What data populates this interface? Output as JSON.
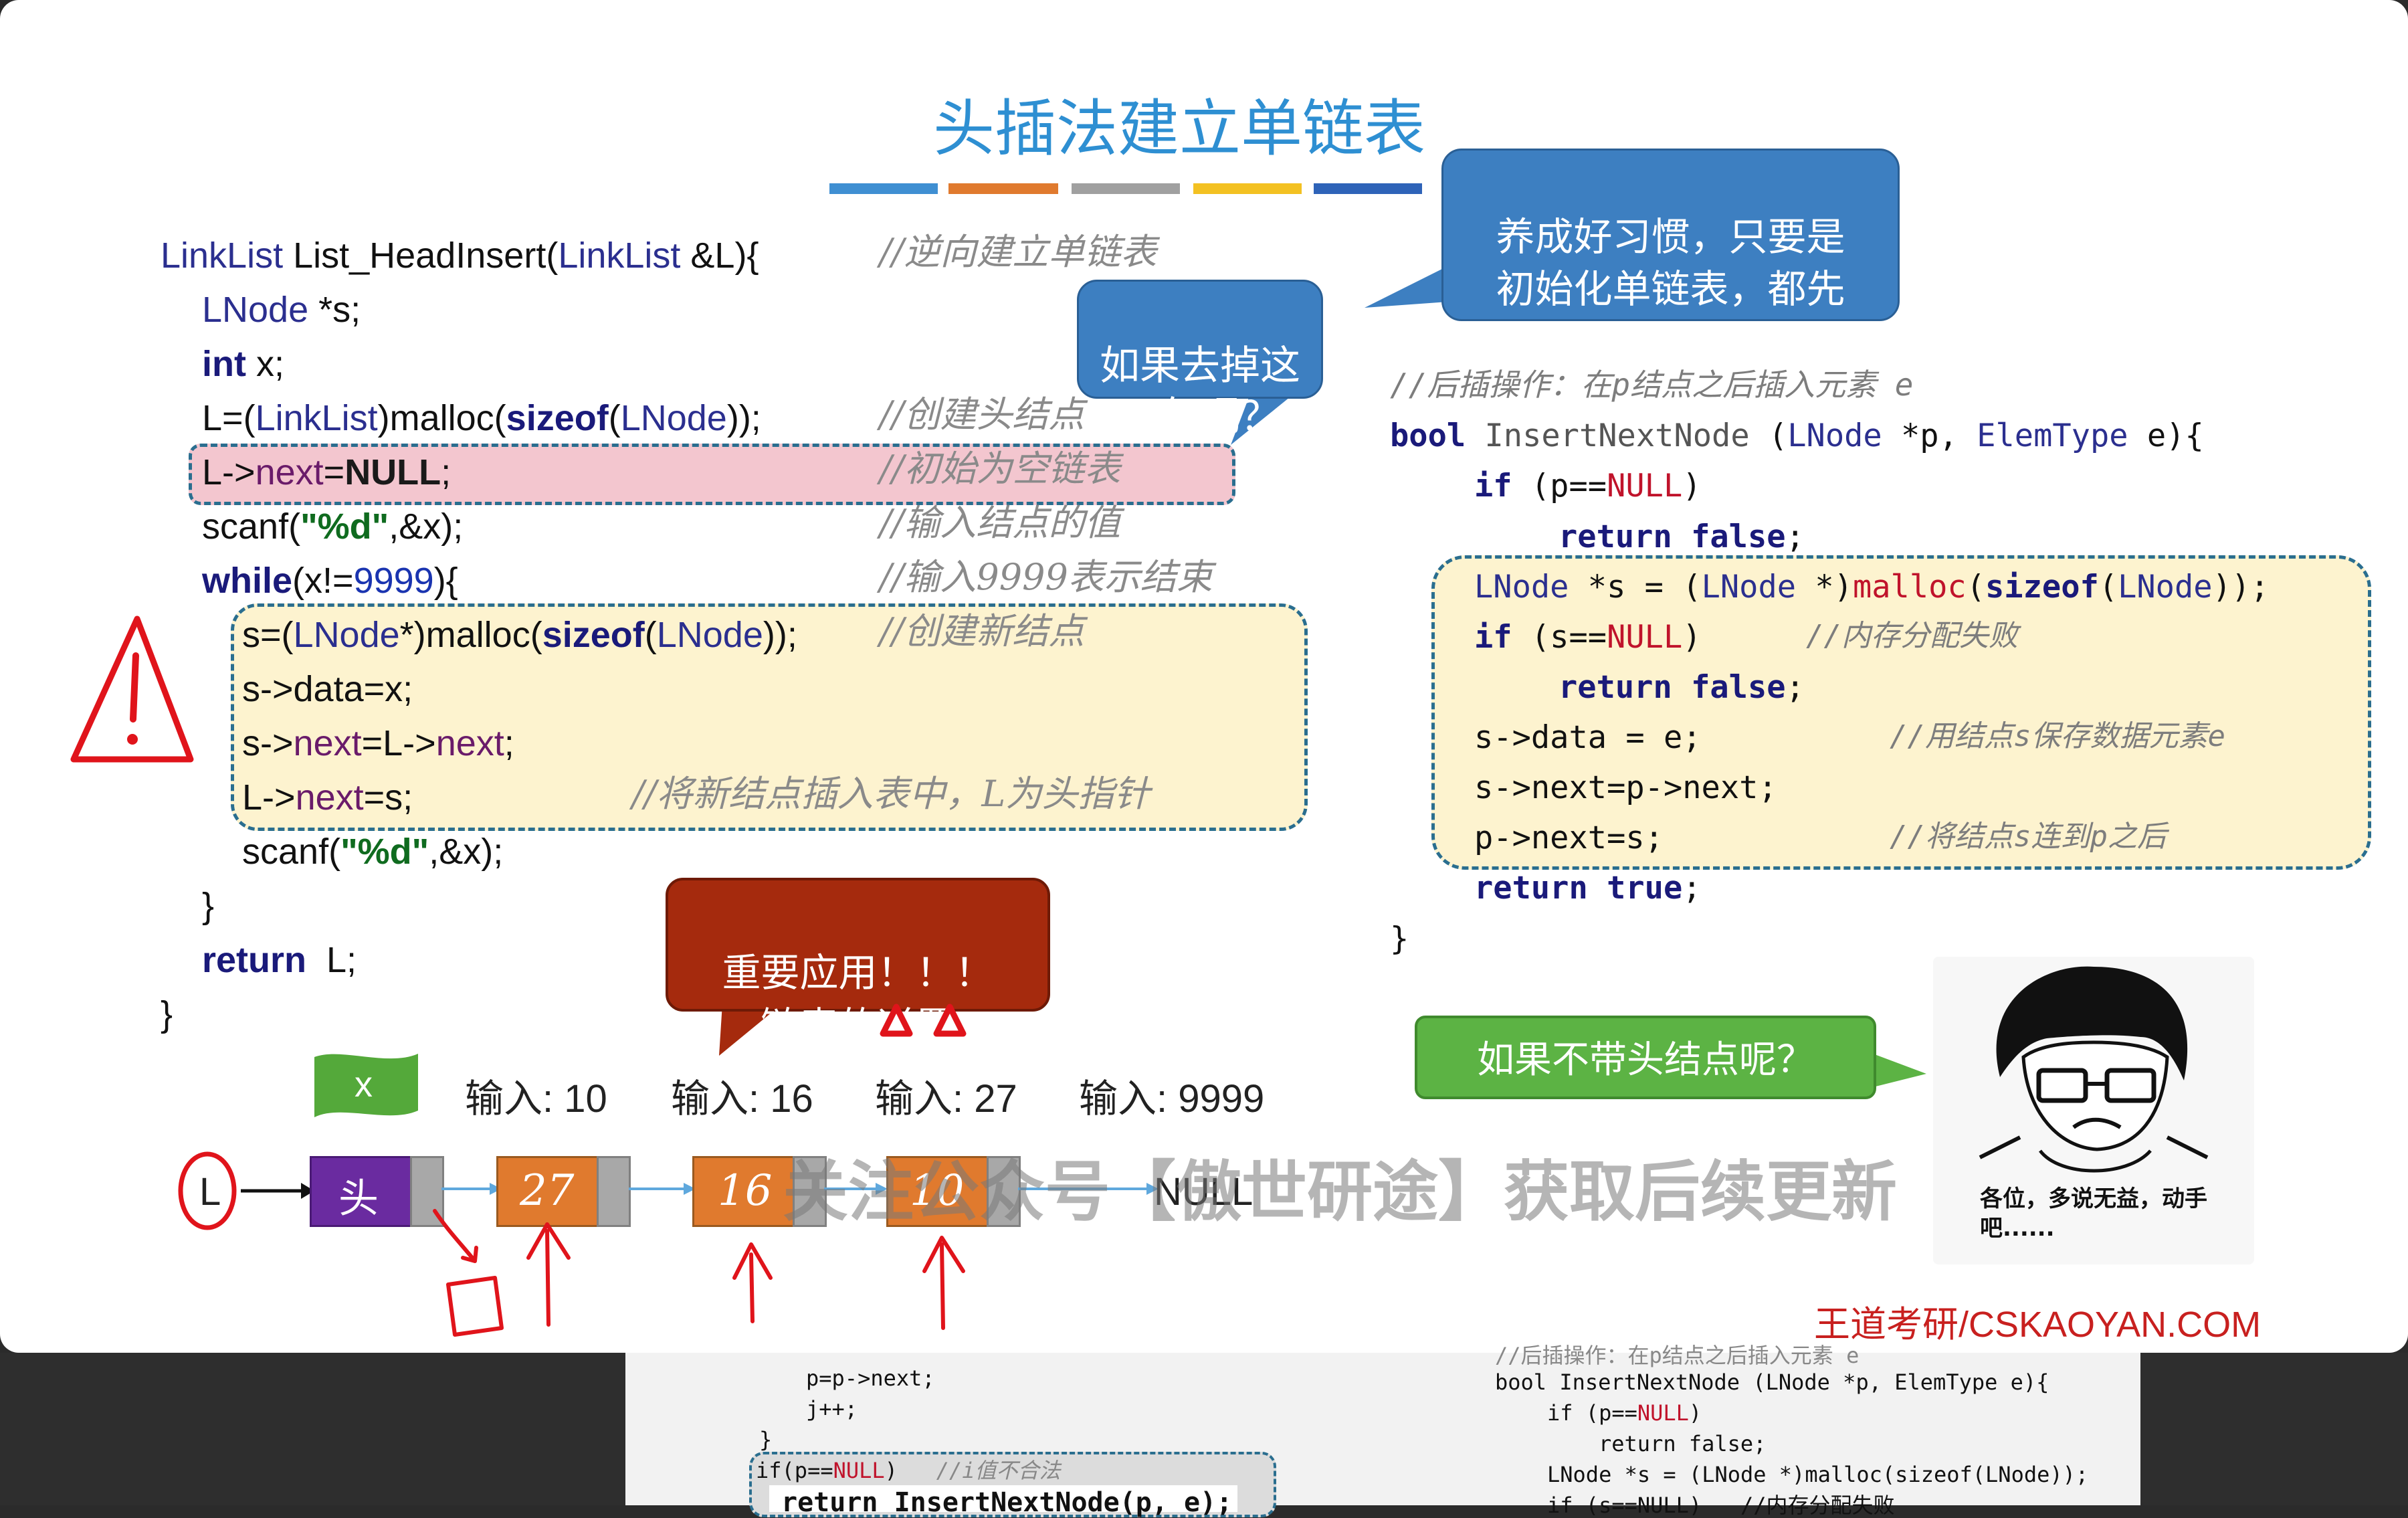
{
  "slide": {
    "title": "头插法建立单链表",
    "accent_colors": [
      "#3f8fd2",
      "#e07a2e",
      "#a0a0a0",
      "#f3c122",
      "#2e63b8"
    ]
  },
  "left_code": {
    "l1": {
      "type": "LinkList",
      "fn": "List_HeadInsert",
      "paren": "(",
      "type2": "LinkList",
      "arg": " &L){",
      "comment": "//逆向建立单链表"
    },
    "l2": {
      "type": "LNode",
      "rest": " *s;"
    },
    "l3": {
      "kw": "int",
      "rest": " x;"
    },
    "l4": {
      "a": "L=(",
      "type": "LinkList",
      "b": ")malloc(",
      "kw": "sizeof",
      "c": "(",
      "type2": "LNode",
      "d": "));",
      "comment": "//创建头结点"
    },
    "l5": {
      "a": "L->",
      "fn": "next",
      "b": "=",
      "kw": "NULL",
      "c": ";",
      "comment": "//初始为空链表"
    },
    "l6": {
      "a": "scanf(",
      "str": "\"%d\"",
      "b": ",&x);",
      "comment": "//输入结点的值"
    },
    "l7": {
      "kw": "while",
      "a": "(x!=",
      "num": "9999",
      "b": "){",
      "comment": "//输入9999表示结束"
    },
    "l8": {
      "a": "s=(",
      "type": "LNode",
      "b": "*)malloc(",
      "kw": "sizeof",
      "c": "(",
      "type2": "LNode",
      "d": "));",
      "comment": "//创建新结点"
    },
    "l9": {
      "a": "s->data=x;"
    },
    "l10": {
      "a": "s->",
      "fn": "next",
      "b": "=L->",
      "fn2": "next",
      "c": ";"
    },
    "l11": {
      "a": "L->",
      "fn": "next",
      "b": "=s;",
      "comment": "//将新结点插入表中，L为头指针"
    },
    "l12": {
      "a": "scanf(",
      "str": "\"%d\"",
      "b": ",&x);"
    },
    "l13": {
      "a": "}"
    },
    "l14": {
      "kw": "return",
      "a": "  L;"
    },
    "l15": {
      "a": "}"
    }
  },
  "right_code": {
    "c0": "//后插操作：在p结点之后插入元素 e",
    "r1": {
      "kw": "bool",
      "fn": " InsertNextNode ",
      "a": "(",
      "type": "LNode",
      "b": " *p, ",
      "type2": "ElemType",
      "c": " e){"
    },
    "r2": {
      "kw": "if",
      "a": " (p==",
      "red": "NULL",
      "b": ")"
    },
    "r3": {
      "kw": "return false",
      "a": ";"
    },
    "r4": {
      "type": "LNode",
      "a": " *s = (",
      "type2": "LNode",
      "b": " *)",
      "red": "malloc",
      "c": "(",
      "kw": "sizeof",
      "d": "(",
      "type3": "LNode",
      "e": "));"
    },
    "r5": {
      "kw": "if",
      "a": " (s==",
      "red": "NULL",
      "b": ")",
      "comment": "//内存分配失败"
    },
    "r6": {
      "kw": "return false",
      "a": ";"
    },
    "r7": {
      "a": "s->data = e;",
      "comment": "//用结点s保存数据元素e"
    },
    "r8": {
      "a": "s->next=p->next;"
    },
    "r9": {
      "a": "p->next=s;",
      "comment": "//将结点s连到p之后"
    },
    "r10": {
      "kw": "return true",
      "a": ";"
    },
    "r11": {
      "a": "}"
    }
  },
  "bubbles": {
    "habit": "养成好习惯，只要是\n初始化单链表，都先\n把头指针指向 NULL",
    "remove": "如果去掉这\n一句呢？",
    "important": "重要应用！！！\n链表的逆置",
    "no_head": "如果不带头结点呢？"
  },
  "demo": {
    "x_label": "x",
    "inputs": [
      "输入: 10",
      "输入: 16",
      "输入: 27",
      "输入: 9999"
    ],
    "L_label": "L",
    "head_label": "头",
    "nodes": [
      "27",
      "16",
      "10"
    ],
    "null_label": "NULL"
  },
  "meme_caption": "各位，多说无益，动手\n吧......",
  "watermark": "关注公众号【傲世研途】获取后续更新",
  "brand": "王道考研/CSKAOYAN.COM",
  "background_page": {
    "b1": "p=p->next;",
    "b2": "j++;",
    "b3": "}",
    "b4a": "if(p==",
    "b4red": "NULL",
    "b4b": ")",
    "b4c": "//i值不合法",
    "b5": "return InsertNextNode(p, e);",
    "r0": "//后插操作：在p结点之后插入元素 e",
    "r1": "bool InsertNextNode (LNode *p, ElemType e){",
    "r2a": "if (p==",
    "r2red": "NULL",
    "r2b": ")",
    "r3": "return false;",
    "r4": "LNode *s = (LNode *)malloc(sizeof(LNode));",
    "r5": "if (s==NULL)   //内存分配失败"
  }
}
